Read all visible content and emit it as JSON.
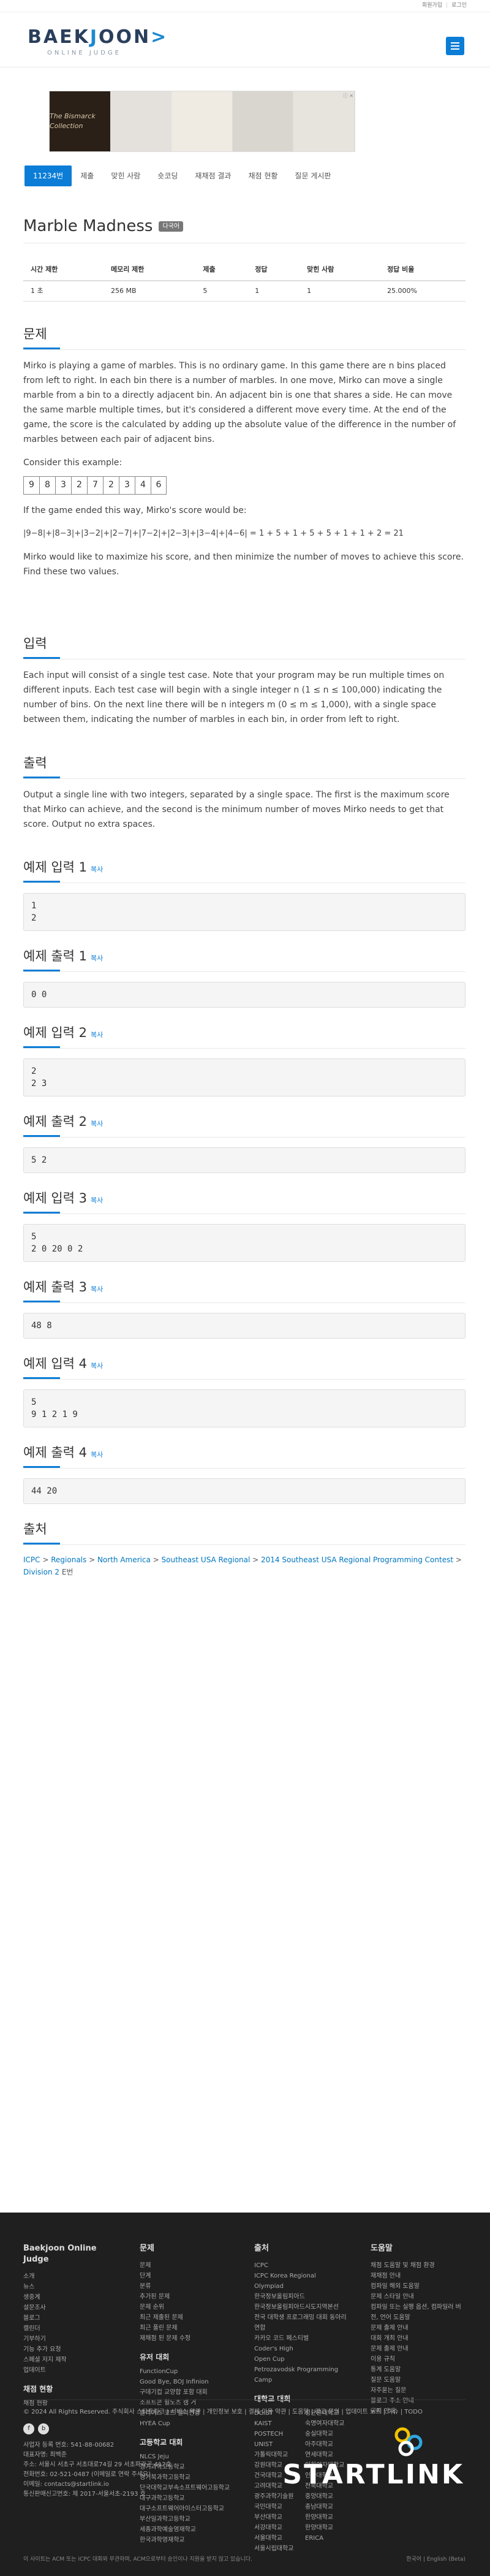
{
  "topbar": {
    "login_label": "회원가입",
    "logout_label": "로그인"
  },
  "logo": {
    "main_left": "BAEK",
    "main_bar": "J",
    "main_right": "OON",
    "sub": "ONLINE JUDGE",
    "arrow": ">"
  },
  "ad": {
    "brand": "The Bismarck Collection",
    "badge": "ⓘ ✕"
  },
  "tabs": [
    {
      "label": "11234번"
    },
    {
      "label": "제출"
    },
    {
      "label": "맞힌 사람"
    },
    {
      "label": "숏코딩"
    },
    {
      "label": "재채점 결과"
    },
    {
      "label": "채점 현황"
    },
    {
      "label": "질문 게시판"
    }
  ],
  "problem": {
    "title": "Marble Madness",
    "badge": "다국어"
  },
  "info": {
    "headers": [
      "시간 제한",
      "메모리 제한",
      "제출",
      "정답",
      "맞힌 사람",
      "정답 비율"
    ],
    "row": [
      "1 초",
      "256 MB",
      "5",
      "1",
      "1",
      "25.000%"
    ]
  },
  "sections": {
    "desc": {
      "heading": "문제",
      "p1": "Mirko is playing a game of marbles. This is no ordinary game. In this game there are n bins placed from left to right. In each bin there is a number of marbles. In one move, Mirko can move a single marble from a bin to a directly adjacent bin. An adjacent bin is one that shares a side. He can move the same marble multiple times, but it's considered a different move every time. At the end of the game, the score is the calculated by adding up the absolute value of the difference in the number of marbles between each pair of adjacent bins.",
      "p2": "Consider this example:",
      "boxes": [
        "9",
        "8",
        "3",
        "2",
        "7",
        "2",
        "3",
        "4",
        "6"
      ],
      "p3": "If the game ended this way, Mirko's score would be:",
      "formula": "|9−8|+|8−3|+|3−2|+|2−7|+|7−2|+|2−3|+|3−4|+|4−6| = 1 + 5 + 1 + 5 + 5 + 1 + 1 + 2 = 21",
      "p4": "Mirko would like to maximize his score, and then minimize the number of moves to achieve this score. Find these two values."
    },
    "input": {
      "heading": "입력",
      "p1": "Each input will consist of a single test case. Note that your program may be run multiple times on different inputs. Each test case will begin with a single integer n (1 ≤ n ≤ 100,000) indicating the number of bins. On the next line there will be n integers m (0 ≤ m ≤ 1,000), with a single space between them, indicating the number of marbles in each bin, in order from left to right."
    },
    "output": {
      "heading": "출력",
      "p1": "Output a single line with two integers, separated by a single space. The first is the maximum score that Mirko can achieve, and the second is the minimum number of moves Mirko needs to get that score. Output no extra spaces."
    },
    "samples": [
      {
        "in_h": "예제 입력 1",
        "in": "1\n2",
        "out_h": "예제 출력 1",
        "out": "0 0"
      },
      {
        "in_h": "예제 입력 2",
        "in": "2\n2 3",
        "out_h": "예제 출력 2",
        "out": "5 2"
      },
      {
        "in_h": "예제 입력 3",
        "in": "5\n2 0 20 0 2",
        "out_h": "예제 출력 3",
        "out": "48 8"
      },
      {
        "in_h": "예제 입력 4",
        "in": "5\n9 1 2 1 9",
        "out_h": "예제 출력 4",
        "out": "44 20"
      }
    ],
    "copy_label": "복사",
    "source": {
      "heading": "출처",
      "l1": "ICPC",
      "l2": "Regionals",
      "l3": "North America",
      "l4": "Southeast USA Regional",
      "l5": "2014 Southeast USA Regional Programming Contest",
      "l6": "Division 2",
      "l7": "E번",
      "sep": " > "
    }
  },
  "footer": {
    "col1": {
      "title": "Baekjoon Online Judge",
      "items": [
        "소개",
        "뉴스",
        "생중계",
        "설문조사",
        "블로그",
        "캘린더",
        "기부하기",
        "기능 추가 요청",
        "스페셜 저지 제작",
        "업데이트"
      ],
      "h2": "채점 현황",
      "items2": [
        "채점 현황"
      ]
    },
    "col2": {
      "title": "문제",
      "items": [
        "문제",
        "단계",
        "분류",
        "추가된 문제",
        "문제 순위",
        "최근 제출된 문제",
        "최근 풀린 문제",
        "재채점 된 문제 수정"
      ],
      "h2": "유저 대회",
      "items2": [
        "FunctionCup",
        "Good Bye, BOJ Infinion",
        "구데기컵 교양합 포함 대회",
        "소프트콘 윌노츠 캠 거",
        "클리어스 코드 챌리컨경",
        "HYEA Cup"
      ],
      "h3": "고등학교 대회",
      "items3": [
        "NLCS Jeju",
        "경기과학고등학교",
        "경기북과학고등학교",
        "단국대학교부속소프트웨어고등학교",
        "대구과학고등학교",
        "대구소프트웨어마이스터고등학교",
        "부산일과학고등학교",
        "세종과학예술영재학교",
        "한국과학영재학교"
      ]
    },
    "col3": {
      "title": "출처",
      "items": [
        "ICPC",
        "ICPC Korea Regional",
        "Olympiad",
        "한국정보올림피아드",
        "한국정보올림피아드시도지역본선",
        "전국 대학생 프로그래밍 대회 동아리 연합",
        "카카오 코드 페스티벌",
        "Coder's High",
        "Open Cup",
        "Petrozavodsk Programming Camp"
      ],
      "h2": "대학교 대회",
      "items2": [
        "DGIST",
        "KAIST",
        "POSTECH",
        "UNIST",
        "가톨릭대학교",
        "강원대학교",
        "건국대학교",
        "고려대학교",
        "광주과학기술원",
        "국민대학교",
        "부산대학교",
        "서강대학교",
        "서울대학교",
        "서울시립대학교",
        "성균관대학교",
        "숙명여자대학교",
        "숭실대학교",
        "아주대학교",
        "연세대학교",
        "이화여자대학교",
        "인하대학교",
        "전북대학교",
        "중앙대학교",
        "충남대학교",
        "한양대학교",
        "한양대학교 ERICA"
      ]
    },
    "col4": {
      "title": "도움말",
      "items": [
        "채점 도움말 및 채점 환경",
        "재채점 안내",
        "컴파일 해외 도움말",
        "문제 스타일 안내",
        "컴파일 또는 실행 옵션, 컴파일러 버전, 언어 도움말",
        "문제 출제 안내",
        "대회 개최 안내",
        "문제 출제 안내",
        "이용 규칙",
        "통계 도움말",
        "질문 도움말",
        "자주묻는 질문",
        "블로그 주소 안내",
        "공지 안내"
      ]
    },
    "bottom": [
      "© 2024 All Rights Reserved. 주식회사 스타트링크  |  서비스 약관  |  개인정보 보호  |  결제 이용 약관  |  도움말  |  광고 문의  |  업데이트 노트  |  이슈  |  TODO",
      "사업자 등록 번호: 541-88-00682",
      "대표자명: 최백준",
      "주소: 서울시 서초구 서초대로74길 29 서초파라곤 412호",
      "전화번호: 02-521-0487 (이메일로 연락 주세요)",
      "이메일: contacts@startlink.io",
      "통신판매신고번호: 제 2017-서울서초-2193 호"
    ],
    "copyright": "이 사이트는 ACM 또는 ICPC 대회와 무관하며, ACM으로부터 승인이나 지원을 받지 않고 있습니다.",
    "lang": "한국어  |  English (Beta)",
    "startlink": "STARTLINK"
  }
}
